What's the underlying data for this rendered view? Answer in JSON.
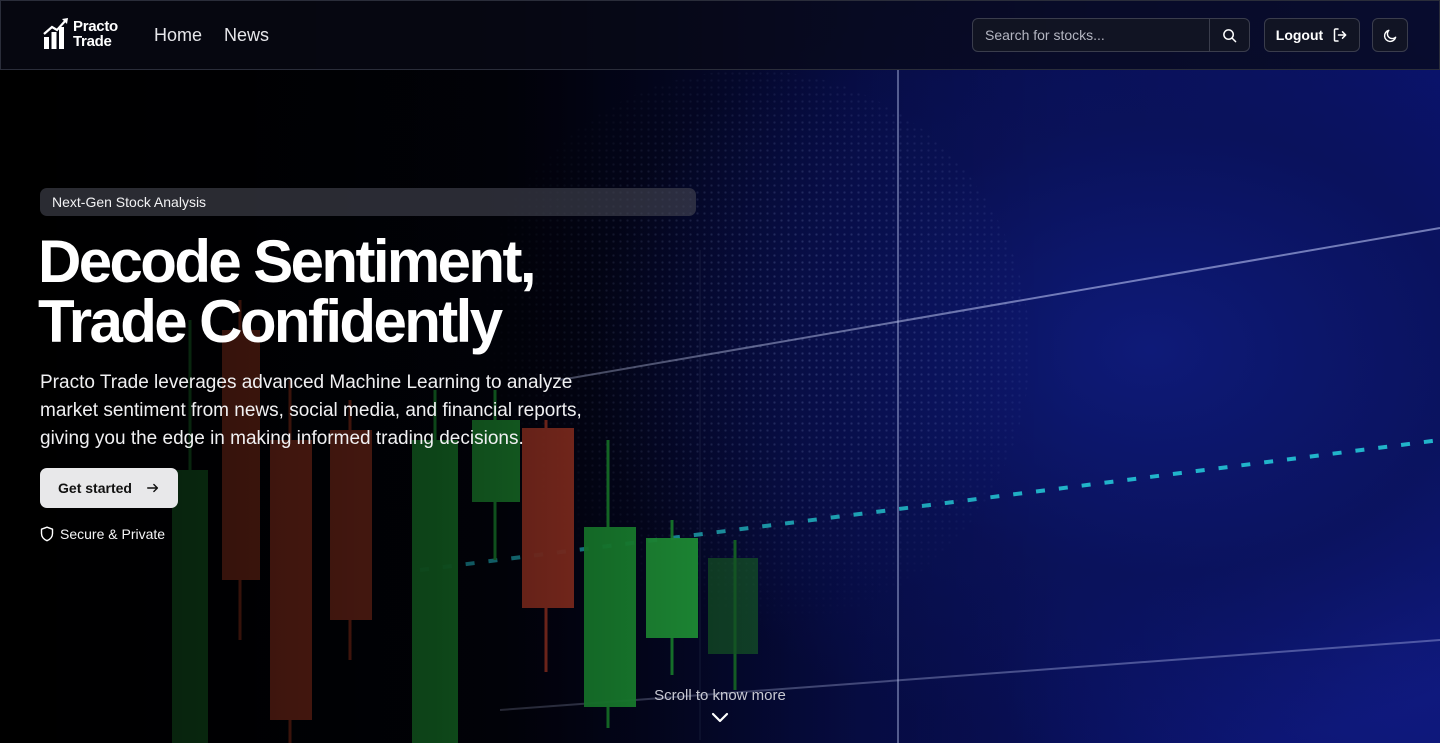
{
  "brand": {
    "name_line1": "Practo",
    "name_line2": "Trade"
  },
  "nav": {
    "links": [
      {
        "label": "Home"
      },
      {
        "label": "News"
      }
    ],
    "search": {
      "placeholder": "Search for stocks..."
    },
    "logout_label": "Logout"
  },
  "hero": {
    "badge": "Next-Gen Stock Analysis",
    "title_line1": "Decode Sentiment,",
    "title_line2": "Trade Confidently",
    "description": "Practo Trade leverages advanced Machine Learning to analyze market sentiment from news, social media, and financial reports, giving you the edge in making informed trading decisions.",
    "cta_label": "Get started",
    "secure_label": "Secure & Private"
  },
  "scroll_hint": "Scroll to know more",
  "icons": {
    "logo": "bar-chart-trend-icon",
    "search": "search-icon",
    "logout": "logout-icon",
    "theme": "moon-icon",
    "cta": "arrow-right-icon",
    "secure": "shield-icon",
    "scroll": "chevron-down-icon"
  },
  "colors": {
    "nav_bg": "#080a16",
    "cta_bg": "#e8e8ea",
    "candle_up": "#1fa23a",
    "candle_down": "#c2412e",
    "trend_line": "#24c6d6"
  }
}
